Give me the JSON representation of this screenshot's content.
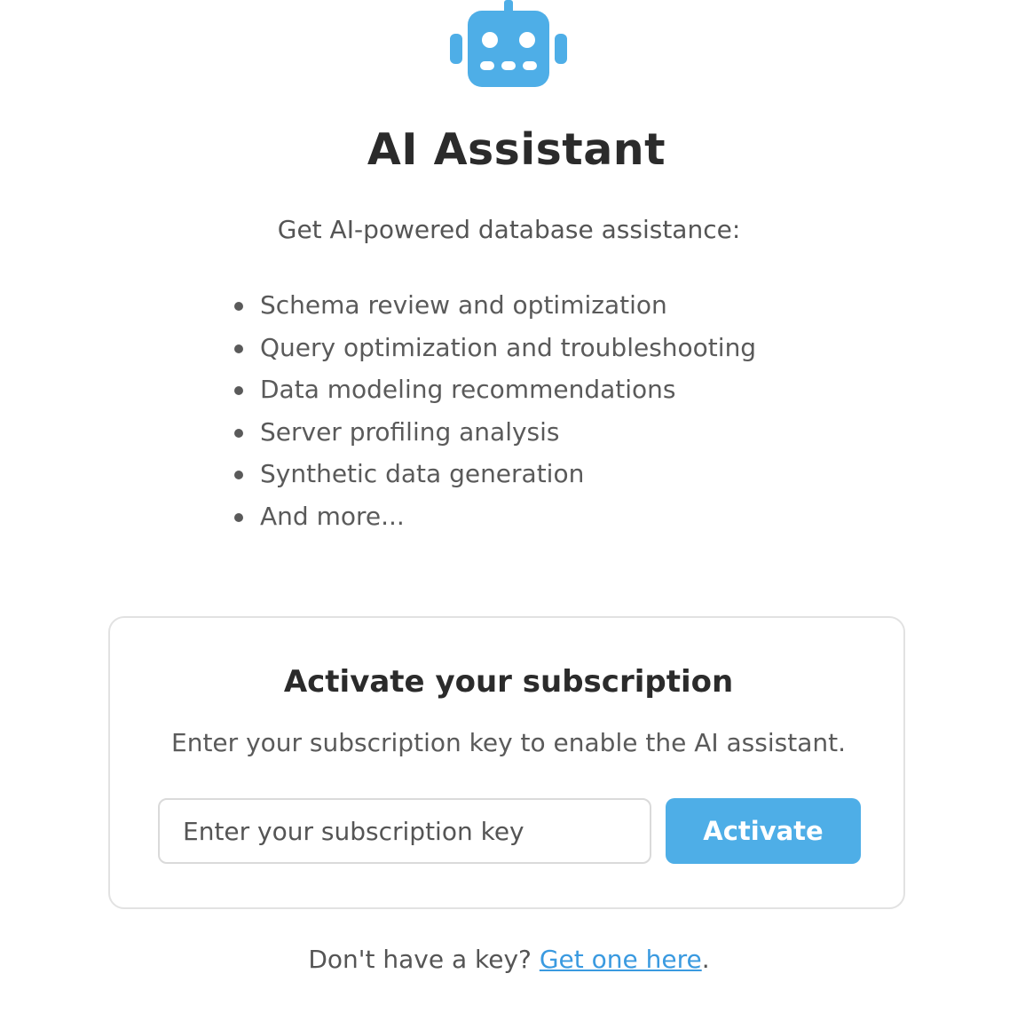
{
  "header": {
    "icon": "robot-icon",
    "title": "AI Assistant"
  },
  "intro": {
    "text": "Get AI-powered database assistance:"
  },
  "features": [
    "Schema review and optimization",
    "Query optimization and troubleshooting",
    "Data modeling recommendations",
    "Server profiling analysis",
    "Synthetic data generation",
    "And more..."
  ],
  "activation": {
    "title": "Activate your subscription",
    "description": "Enter your subscription key to enable the AI assistant.",
    "input_placeholder": "Enter your subscription key",
    "input_value": "",
    "button_label": "Activate"
  },
  "footer": {
    "prefix": "Don't have a key? ",
    "link_text": "Get one here",
    "suffix": "."
  },
  "colors": {
    "accent": "#4eaee7",
    "link": "#3a9ae0"
  }
}
